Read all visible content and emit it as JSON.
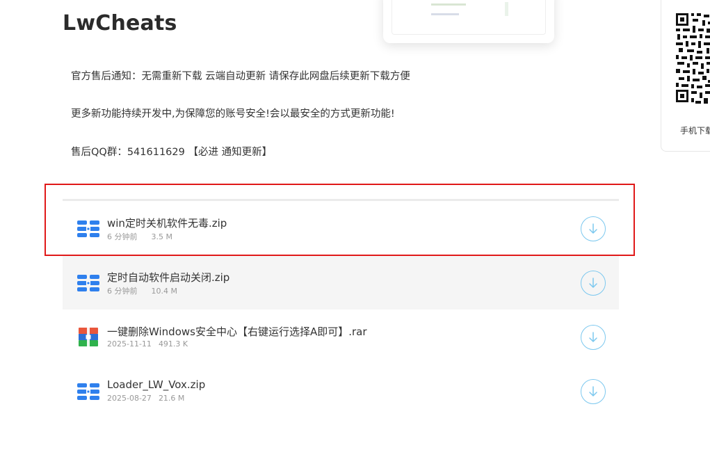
{
  "site": {
    "title": "LwCheats"
  },
  "notices": [
    "官方售后通知：无需重新下载 云端自动更新 请保存此网盘后续更新下载方便",
    "更多新功能持续开发中,为保障您的账号安全!会以最安全的方式更新功能!",
    "售后QQ群：541611629 【必进 通知更新】"
  ],
  "files": [
    {
      "name": "win定时关机软件无毒.zip",
      "date": "6 分钟前",
      "size": "3.5 M",
      "icon": "zip-archive-icon"
    },
    {
      "name": "定时自动软件启动关闭.zip",
      "date": "6 分钟前",
      "size": "10.4 M",
      "icon": "zip-archive-icon"
    },
    {
      "name": "一键删除Windows安全中心【右键运行选择A即可】.rar",
      "date": "2025-11-11",
      "size": "491.3 K",
      "icon": "rar-archive-icon"
    },
    {
      "name": "Loader_LW_Vox.zip",
      "date": "2025-08-27",
      "size": "21.6 M",
      "icon": "zip-archive-icon"
    }
  ],
  "side_panel": {
    "caption": "手机下载"
  },
  "colors": {
    "zip_icon": "#2f80ed",
    "rar_red": "#e9563c",
    "rar_blue": "#2d6fd6",
    "rar_green": "#2fb24c",
    "download_ring": "#7cc8ef",
    "highlight": "#e01818",
    "hover_row": "#f5f5f5"
  },
  "icons": {
    "download": "download-arrow-icon",
    "qr": "qr-code-icon"
  }
}
